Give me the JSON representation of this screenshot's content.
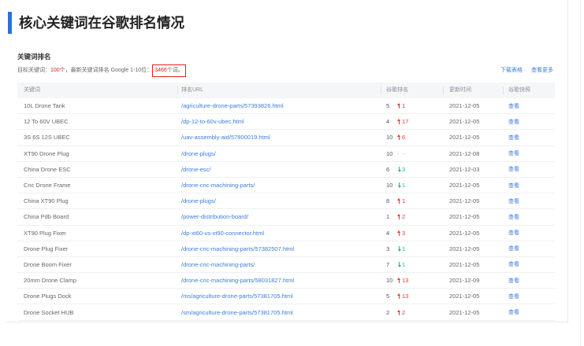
{
  "header": {
    "title": "核心关键词在谷歌排名情况"
  },
  "section": {
    "title": "关键词排名",
    "summary": {
      "prefix": "目标关键词：",
      "target_count": "100个",
      "middle": "，最新关键词排名 Google 1-10位：",
      "top10_count": "3466",
      "top10_unit": "个词。"
    },
    "actions": {
      "download": "下载表格",
      "more": "查看更多"
    }
  },
  "table": {
    "columns": [
      "关键词",
      "排名URL",
      "谷歌排名",
      "更新时间",
      "谷歌快照"
    ],
    "rows": [
      {
        "keyword": "10L Drone Tank",
        "url": "/agriculture-drone-parts/57393826.html",
        "rank": "5",
        "change_icon": "arrow-up-icon",
        "change": "1",
        "updated": "2021-12-05",
        "snapshot": "查看"
      },
      {
        "keyword": "12 To 60V UBEC",
        "url": "/dp-12-to-60v-ubec.html",
        "rank": "4",
        "change_icon": "arrow-up-icon",
        "change": "17",
        "updated": "2021-12-05",
        "snapshot": "查看"
      },
      {
        "keyword": "3S 6S 12S UBEC",
        "url": "/uav-assembly-aid/57800019.html",
        "rank": "10",
        "change_icon": "arrow-up-icon",
        "change": "6",
        "updated": "2021-12-05",
        "snapshot": "查看"
      },
      {
        "keyword": "XT90 Drone Plug",
        "url": "/drone-plugs/",
        "rank": "10",
        "change_icon": null,
        "change": "- -",
        "updated": "2021-12-08",
        "snapshot": "查看"
      },
      {
        "keyword": "China Drone ESC",
        "url": "/drone-esc/",
        "rank": "6",
        "change_icon": "arrow-down-icon",
        "change": "3",
        "updated": "2021-12-03",
        "snapshot": "查看"
      },
      {
        "keyword": "Cnc Drone Frame",
        "url": "/drone-cnc-machining-parts/",
        "rank": "10",
        "change_icon": "arrow-down-icon",
        "change": "1",
        "updated": "2021-12-05",
        "snapshot": "查看"
      },
      {
        "keyword": "China XT90 Plug",
        "url": "/drone-plugs/",
        "rank": "8",
        "change_icon": "arrow-up-icon",
        "change": "1",
        "updated": "2021-12-05",
        "snapshot": "查看"
      },
      {
        "keyword": "China Pdb Board",
        "url": "/power-distribution-board/",
        "rank": "1",
        "change_icon": "arrow-up-icon",
        "change": "2",
        "updated": "2021-12-05",
        "snapshot": "查看"
      },
      {
        "keyword": "XT90 Plug Fixer",
        "url": "/dp-xt60-vs-xt90-connector.html",
        "rank": "4",
        "change_icon": "arrow-up-icon",
        "change": "3",
        "updated": "2021-12-05",
        "snapshot": "查看"
      },
      {
        "keyword": "Drone Plug Fixer",
        "url": "/drone-cnc-machining-parts/57382507.html",
        "rank": "3",
        "change_icon": "arrow-down-icon",
        "change": "1",
        "updated": "2021-12-05",
        "snapshot": "查看"
      },
      {
        "keyword": "Drone Boom Fixer",
        "url": "/drone-cnc-machining-parts/",
        "rank": "7",
        "change_icon": "arrow-down-icon",
        "change": "1",
        "updated": "2021-12-05",
        "snapshot": "查看"
      },
      {
        "keyword": "20mm Drone Clamp",
        "url": "/drone-cnc-machining-parts/58031827.html",
        "rank": "10",
        "change_icon": "arrow-up-icon",
        "change": "13",
        "updated": "2021-12-09",
        "snapshot": "查看"
      },
      {
        "keyword": "Drone Plugs Dock",
        "url": "/ms/agriculture-drone-parts/57381705.html",
        "rank": "5",
        "change_icon": "arrow-up-icon",
        "change": "13",
        "updated": "2021-12-05",
        "snapshot": "查看"
      },
      {
        "keyword": "Drone Socket HUB",
        "url": "/sm/agriculture-drone-parts/57381705.html",
        "rank": "2",
        "change_icon": "arrow-up-icon",
        "change": "2",
        "updated": "2021-12-05",
        "snapshot": "查看"
      }
    ]
  },
  "colors": {
    "accent": "#2f6fde",
    "rank_up": "#e8382f",
    "rank_down": "#1fb394",
    "link": "#3b7ddd",
    "highlight": "#e02020"
  }
}
